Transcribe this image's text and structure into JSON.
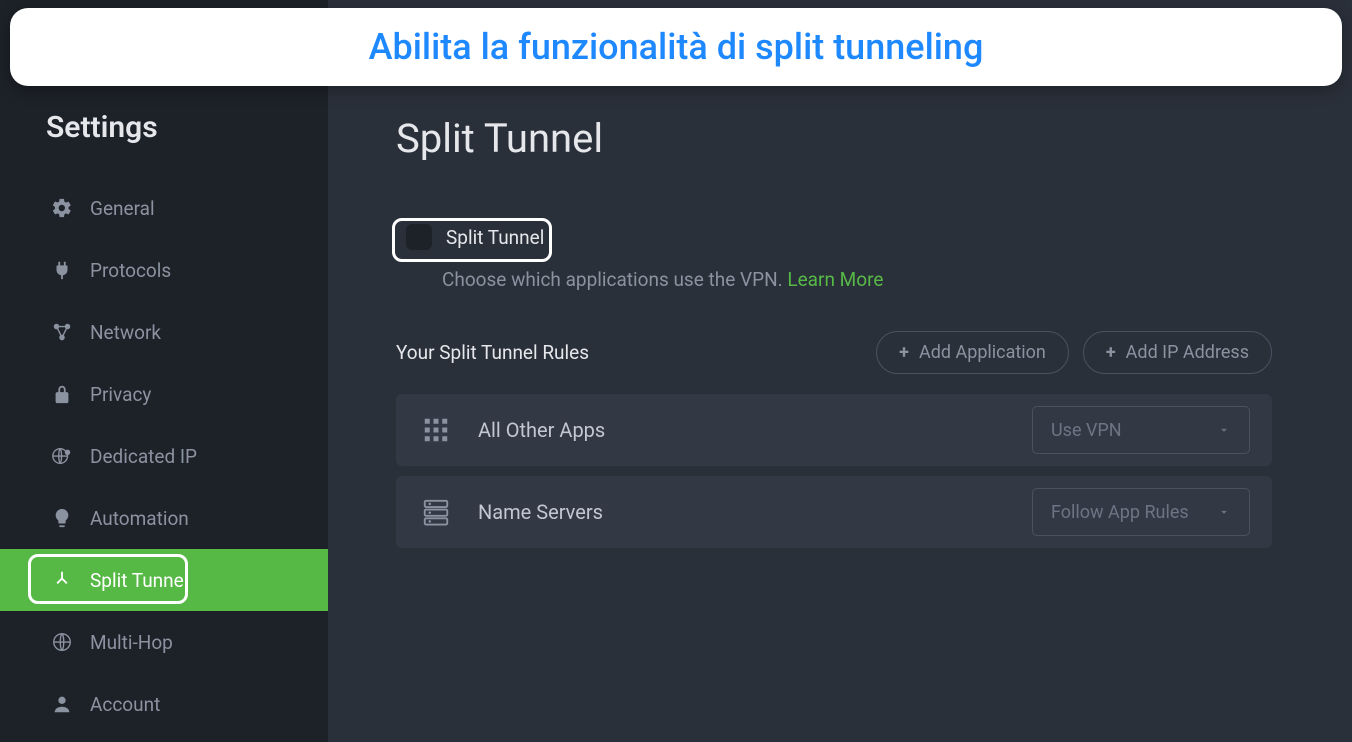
{
  "banner": {
    "text": "Abilita la funzionalità di split tunneling"
  },
  "sidebar": {
    "title": "Settings",
    "items": [
      {
        "label": "General",
        "icon": "gear"
      },
      {
        "label": "Protocols",
        "icon": "plug"
      },
      {
        "label": "Network",
        "icon": "network"
      },
      {
        "label": "Privacy",
        "icon": "lock"
      },
      {
        "label": "Dedicated IP",
        "icon": "globe-pin"
      },
      {
        "label": "Automation",
        "icon": "bulb"
      },
      {
        "label": "Split Tunnel",
        "icon": "split"
      },
      {
        "label": "Multi-Hop",
        "icon": "globe"
      },
      {
        "label": "Account",
        "icon": "person"
      }
    ]
  },
  "main": {
    "title": "Split Tunnel",
    "toggle_label": "Split Tunnel",
    "help_text": "Choose which applications use the VPN. ",
    "learn_more": "Learn More",
    "rules_title": "Your Split Tunnel Rules",
    "add_app": "Add Application",
    "add_ip": "Add IP Address",
    "rules": [
      {
        "label": "All Other Apps",
        "select": "Use VPN",
        "icon": "grid"
      },
      {
        "label": "Name Servers",
        "select": "Follow App Rules",
        "icon": "servers"
      }
    ]
  }
}
